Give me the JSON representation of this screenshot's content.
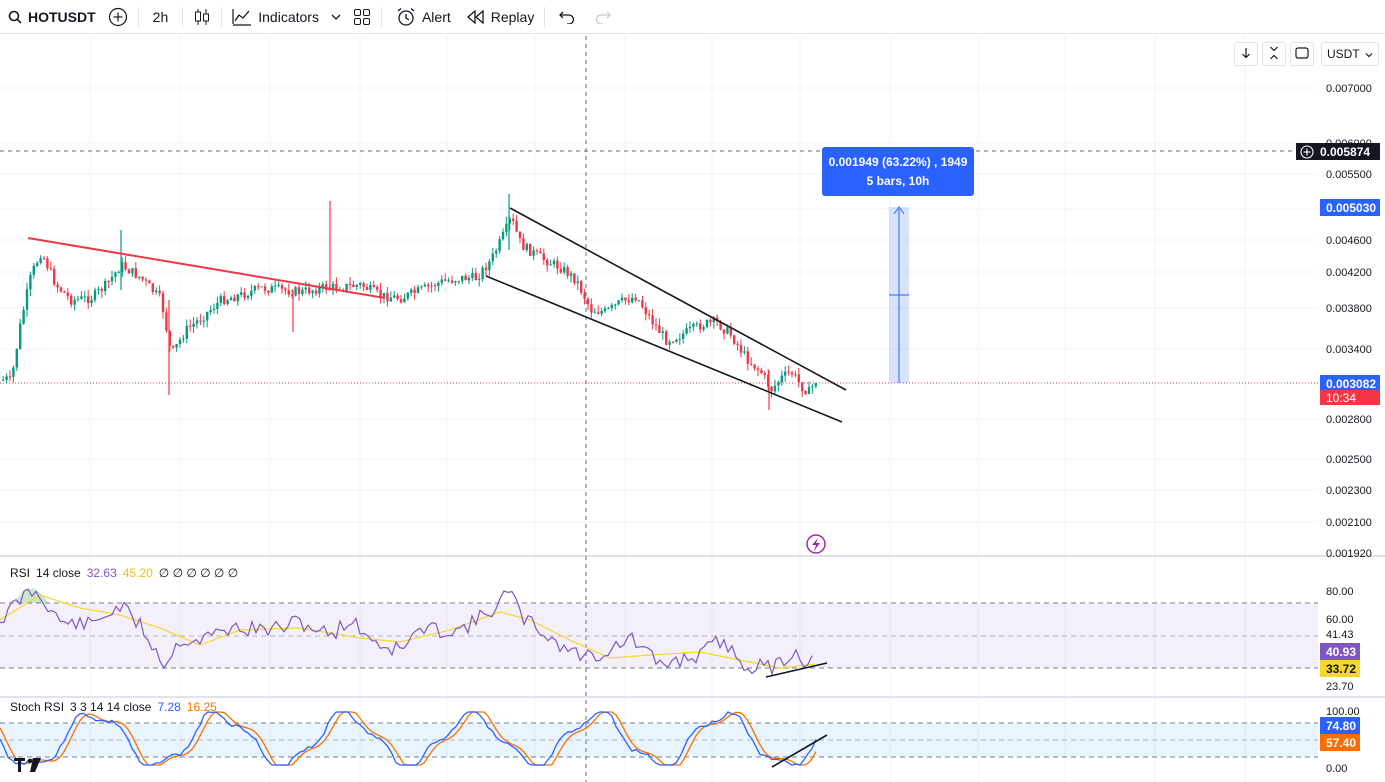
{
  "toolbar": {
    "symbol": "HOTUSDT",
    "interval": "2h",
    "indicators_label": "Indicators",
    "alert_label": "Alert",
    "replay_label": "Replay"
  },
  "price_axis": {
    "currency": "USDT",
    "labels": [
      "0.007000",
      "0.006000",
      "0.005500",
      "0.004600",
      "0.004200",
      "0.003800",
      "0.003400",
      "0.002800",
      "0.002500",
      "0.002300",
      "0.002100",
      "0.001920"
    ],
    "tags": {
      "crosshair_price": "0.005874",
      "target_price": "0.005030",
      "last_price": "0.003082",
      "countdown": "10:34"
    },
    "colors": {
      "crosshair": "#131722",
      "target": "#2962ff",
      "last": "#f23645"
    }
  },
  "measure": {
    "line1": "0.001949 (63.22%) , 1949",
    "line2": "5 bars, 10h"
  },
  "rsi": {
    "label": "RSI",
    "params": "14 close",
    "value1": "32.63",
    "value2": "45.20",
    "extra": "∅ ∅ ∅ ∅ ∅ ∅",
    "axis": [
      "80.00",
      "60.00",
      "41.43",
      "23.70"
    ],
    "tags": {
      "rsi": "40.93",
      "ma": "33.72"
    },
    "colors": {
      "rsi": "#7e57c2",
      "ma": "#f5d82c"
    }
  },
  "stoch": {
    "label": "Stoch RSI",
    "params": "3 3 14 14 close",
    "k": "7.28",
    "d": "16.25",
    "axis": [
      "100.00",
      "0.00"
    ],
    "tags": {
      "k": "74.80",
      "d": "57.40"
    },
    "colors": {
      "k": "#2962ff",
      "d": "#ff6d00"
    }
  }
}
